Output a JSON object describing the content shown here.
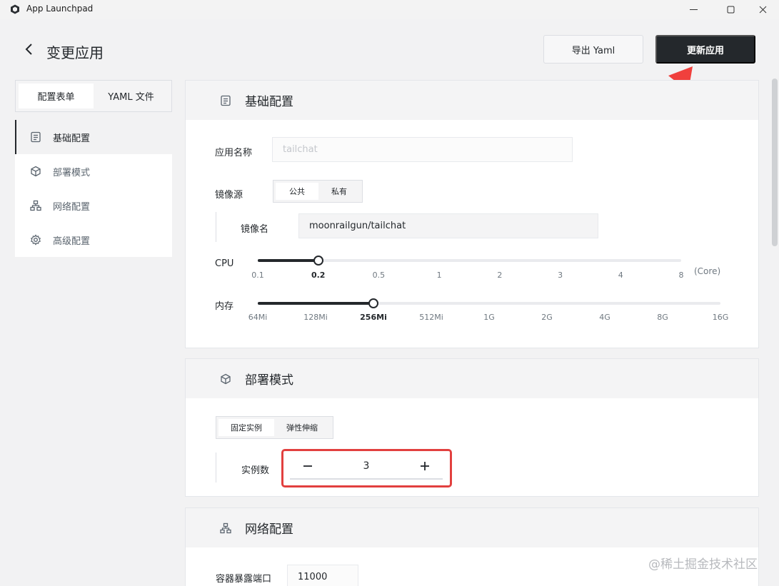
{
  "window": {
    "title": "App Launchpad"
  },
  "header": {
    "title": "变更应用",
    "export_label": "导出 Yaml",
    "update_label": "更新应用"
  },
  "mode_switch": {
    "options": [
      "配置表单",
      "YAML 文件"
    ],
    "active": "配置表单"
  },
  "nav": {
    "items": [
      {
        "label": "基础配置",
        "icon": "file-text-icon",
        "active": true
      },
      {
        "label": "部署模式",
        "icon": "cube-icon",
        "active": false
      },
      {
        "label": "网络配置",
        "icon": "network-icon",
        "active": false
      },
      {
        "label": "高级配置",
        "icon": "gear-icon",
        "active": false
      }
    ]
  },
  "basic": {
    "title": "基础配置",
    "app_name_label": "应用名称",
    "app_name_value": "tailchat",
    "image_source_label": "镜像源",
    "image_source_options": [
      "公共",
      "私有"
    ],
    "image_source_selected": "公共",
    "image_name_label": "镜像名",
    "image_name_value": "moonrailgun/tailchat",
    "cpu": {
      "label": "CPU",
      "ticks": [
        "0.1",
        "0.2",
        "0.5",
        "1",
        "2",
        "3",
        "4",
        "8"
      ],
      "selected": "0.2",
      "unit": "(Core)"
    },
    "memory": {
      "label": "内存",
      "ticks": [
        "64Mi",
        "128Mi",
        "256Mi",
        "512Mi",
        "1G",
        "2G",
        "4G",
        "8G",
        "16G"
      ],
      "selected": "256Mi"
    }
  },
  "deploy": {
    "title": "部署模式",
    "mode_options": [
      "固定实例",
      "弹性伸缩"
    ],
    "mode_selected": "固定实例",
    "instances_label": "实例数",
    "instances_value": "3"
  },
  "network": {
    "title": "网络配置",
    "port_label": "容器暴露端口",
    "port_value": "11000"
  },
  "watermark": "@稀土掘金技术社区",
  "colors": {
    "primary": "#24282c",
    "highlight": "#e2403f",
    "arrow": "#f0403d",
    "background": "#f2f2f3"
  }
}
